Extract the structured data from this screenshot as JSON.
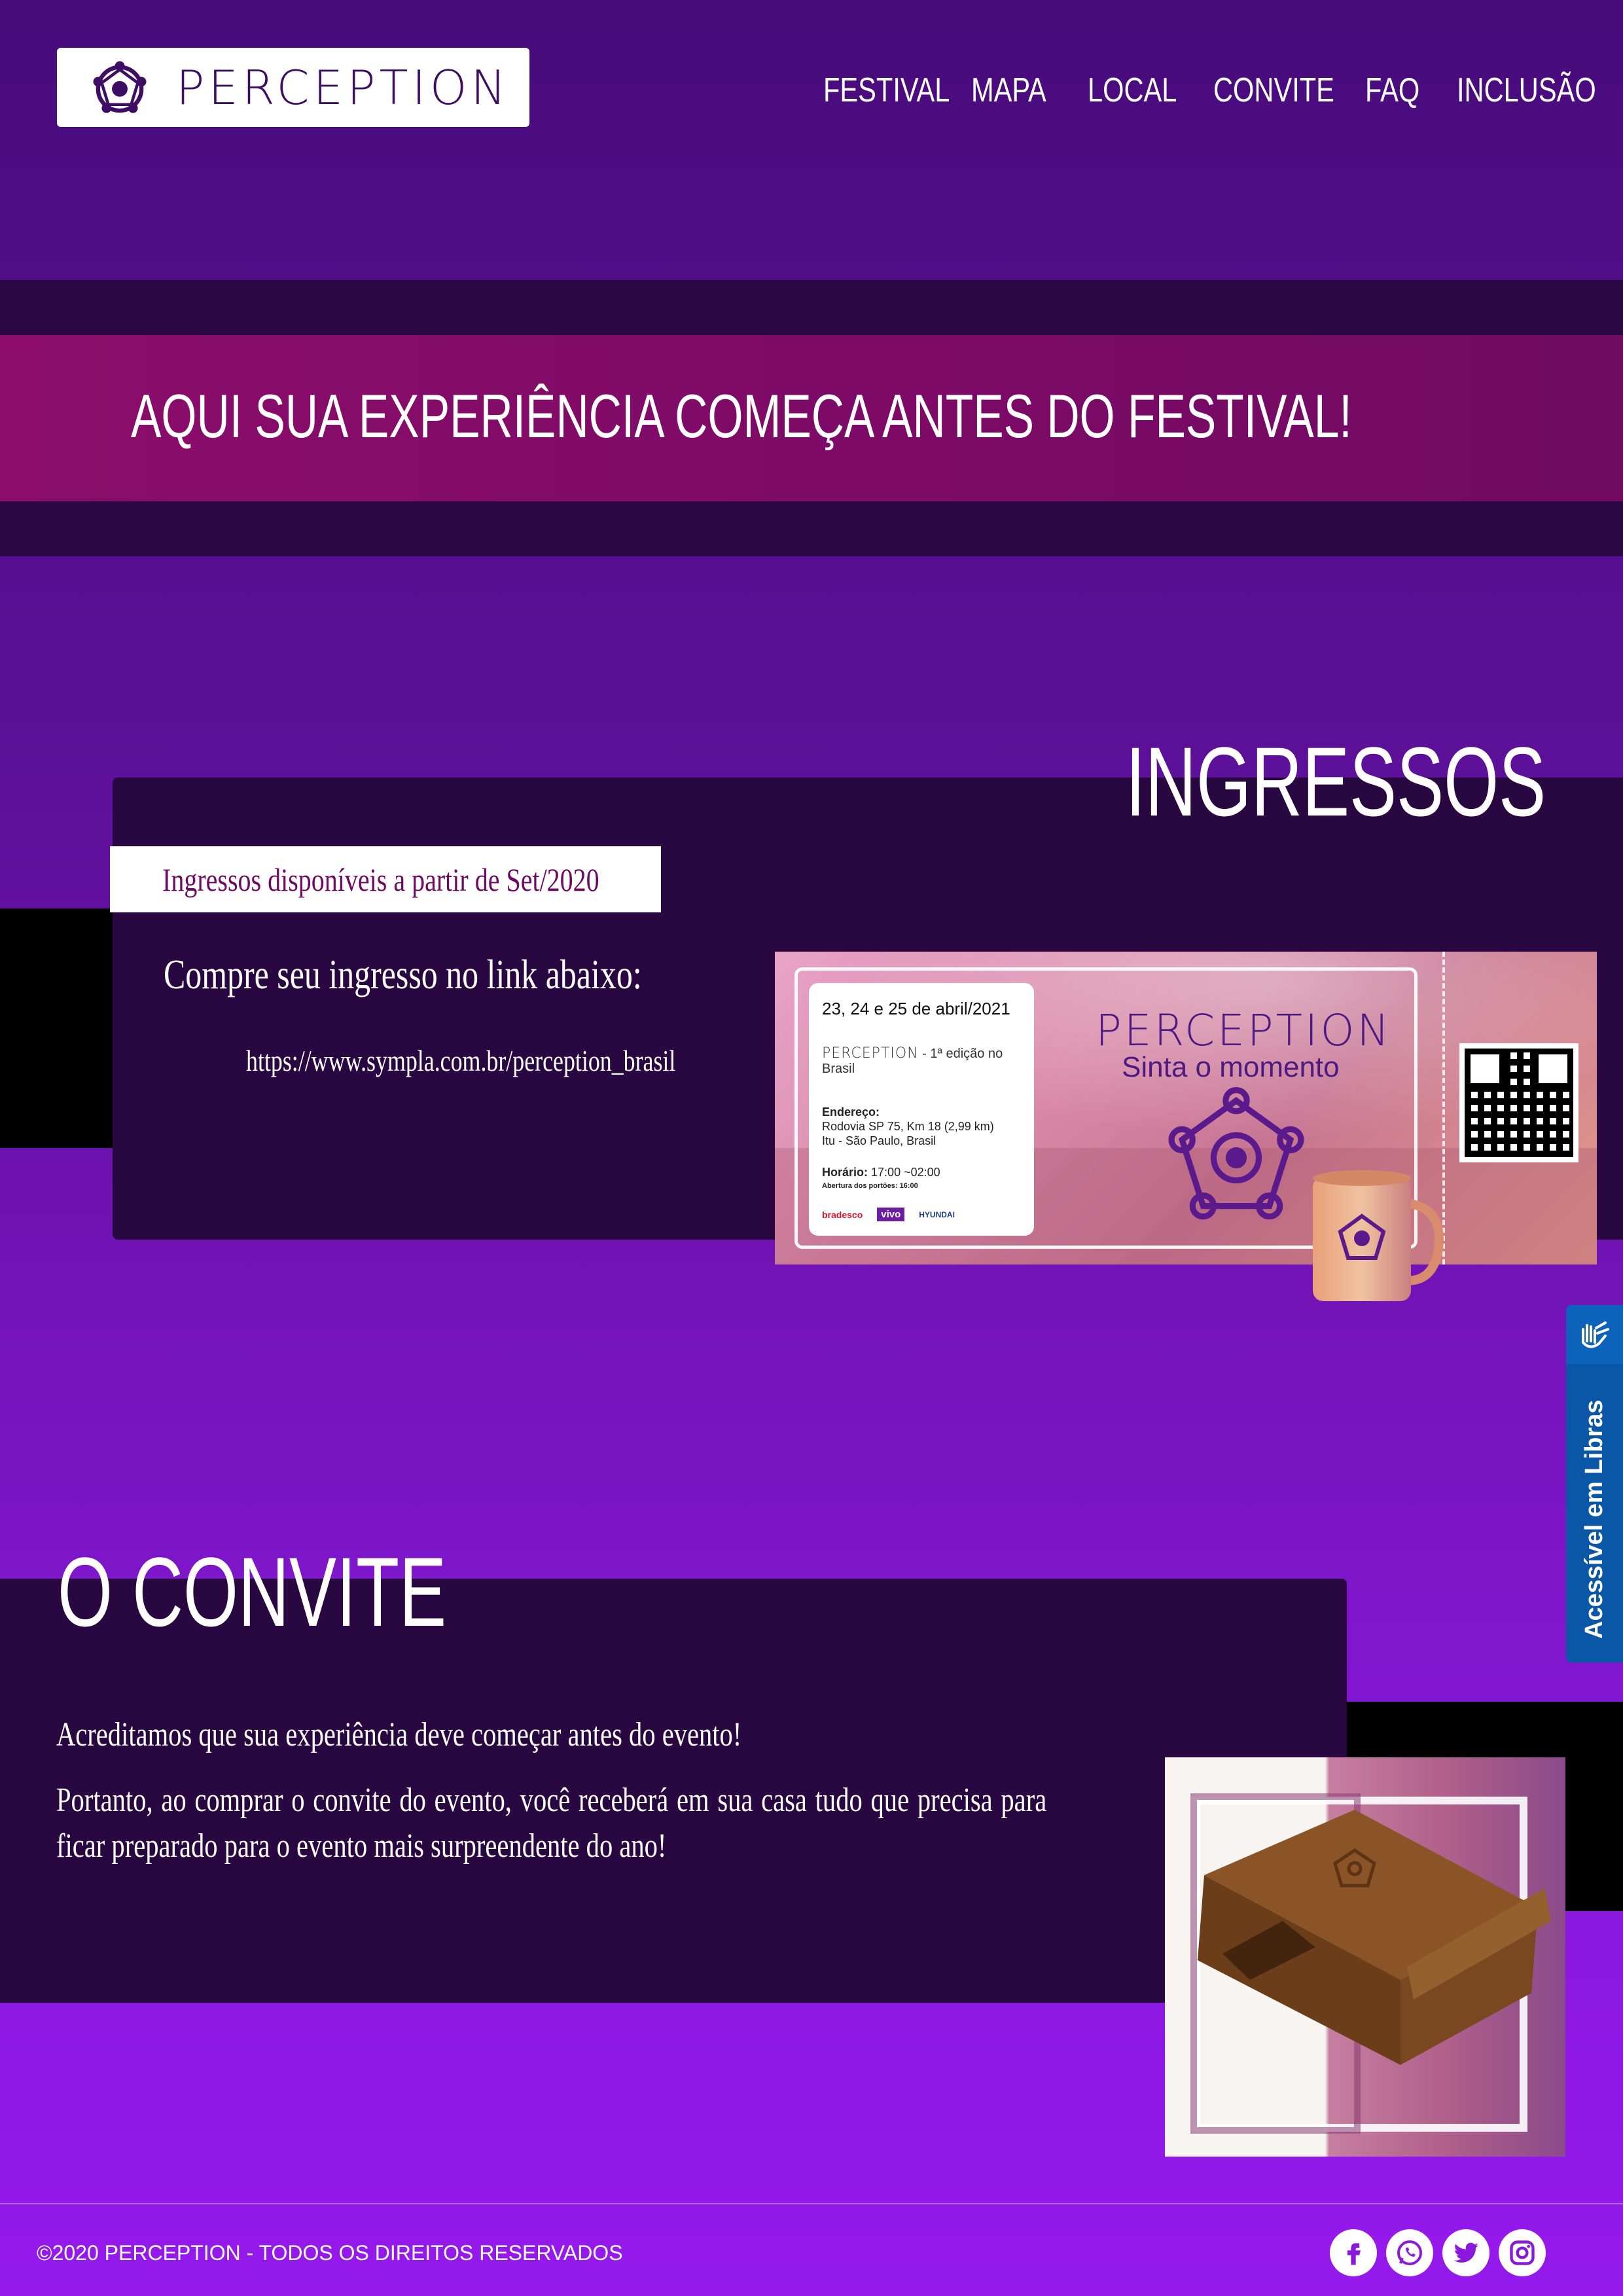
{
  "header": {
    "logo_text": "PERCEPTION",
    "nav": [
      "FESTIVAL",
      "MAPA",
      "LOCAL",
      "CONVITE",
      "FAQ",
      "INCLUSÃO"
    ]
  },
  "banner": {
    "text": "AQUI SUA EXPERIÊNCIA COMEÇA ANTES DO FESTIVAL!"
  },
  "ingressos": {
    "title": "INGRESSOS",
    "badge": "Ingressos disponíveis a partir de Set/2020",
    "buy_text": "Compre seu ingresso no link abaixo:",
    "link": "https://www.sympla.com.br/perception_brasil",
    "ticket": {
      "date": "23, 24 e 25 de abril/2021",
      "brand": "PERCEPTION",
      "edition": "- 1ª edição no Brasil",
      "address_label": "Endereço:",
      "address_line1": "Rodovia SP 75, Km 18 (2,99 km)",
      "address_line2": "Itu - São Paulo, Brasil",
      "hours_label": "Horário:",
      "hours": "17:00 ~02:00",
      "gates": "Abertura dos portões: 16:00",
      "sponsors": [
        "bradesco",
        "vivo",
        "HYUNDAI"
      ],
      "headline": "PERCEPTION",
      "tagline": "Sinta o momento"
    }
  },
  "convite": {
    "title": "O CONVITE",
    "p1": "Acreditamos que sua experiência deve começar antes do evento!",
    "p2": "Portanto, ao comprar o convite do evento, você receberá em sua casa tudo que precisa para ficar preparado para o evento mais surpreendente do ano!"
  },
  "footer": {
    "copyright": "©2020 PERCEPTION - TODOS OS DIREITOS RESERVADOS",
    "social": [
      "facebook-icon",
      "whatsapp-icon",
      "twitter-icon",
      "instagram-icon"
    ]
  },
  "libras": {
    "label": "Acessível em Libras"
  },
  "colors": {
    "bg_top": "#470c7a",
    "bg_bottom": "#9519ec",
    "panel": "#290740",
    "banner": "#8c0d6b",
    "libras": "#0a57a8"
  }
}
